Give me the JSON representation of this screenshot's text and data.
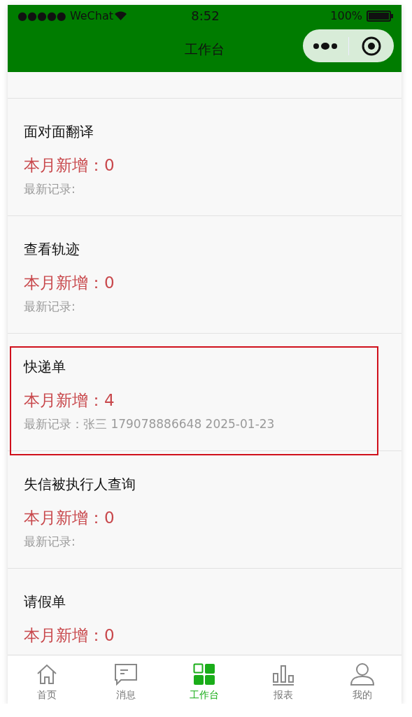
{
  "status_bar": {
    "carrier": "●●●●● WeChat",
    "time": "8:52",
    "battery": "100%"
  },
  "nav_bar": {
    "title": "工作台"
  },
  "cards": [
    {
      "title": "面对面翻译",
      "count": "本月新增：0",
      "record": "最新记录:",
      "selected": false
    },
    {
      "title": "查看轨迹",
      "count": "本月新增：0",
      "record": "最新记录:",
      "selected": false
    },
    {
      "title": "快递单",
      "count": "本月新增：4",
      "record": "最新记录：张三 179078886648 2025-01-23",
      "selected": true
    },
    {
      "title": "失信被执行人查询",
      "count": "本月新增：0",
      "record": "最新记录:",
      "selected": false
    },
    {
      "title": "请假单",
      "count": "本月新增：0",
      "selected": false
    }
  ],
  "tab_bar": [
    {
      "kind": "home",
      "label": "首页",
      "selected": false
    },
    {
      "kind": "message",
      "label": "消息",
      "selected": false
    },
    {
      "kind": "grid",
      "label": "工作台",
      "selected": true
    },
    {
      "kind": "chart",
      "label": "报表",
      "selected": false
    },
    {
      "kind": "person",
      "label": "我的",
      "selected": false
    }
  ]
}
